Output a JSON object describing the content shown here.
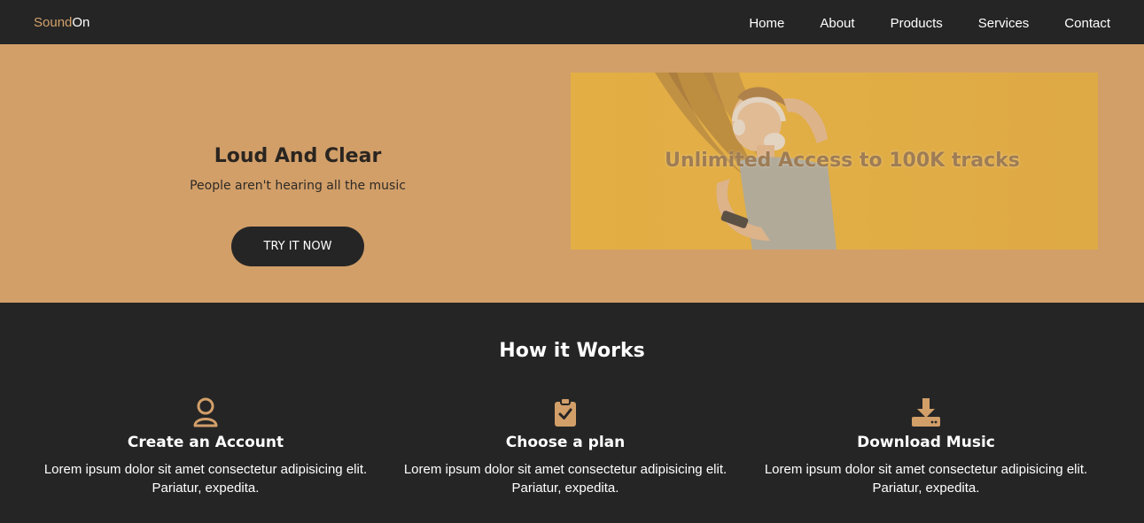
{
  "nav": {
    "logo_part1": "Sound",
    "logo_part2": "On",
    "links": [
      "Home",
      "About",
      "Products",
      "Services",
      "Contact"
    ]
  },
  "hero": {
    "title": "Loud And Clear",
    "subtitle": "People aren't hearing all the music",
    "button": "TRY IT NOW",
    "image_text": "Unlimited Access to 100K tracks"
  },
  "how": {
    "title": "How it Works",
    "steps": [
      {
        "icon": "user-icon",
        "title": "Create an Account",
        "text": "Lorem ipsum dolor sit amet consectetur adipisicing elit. Pariatur, expedita."
      },
      {
        "icon": "clipboard-check-icon",
        "title": "Choose a plan",
        "text": "Lorem ipsum dolor sit amet consectetur adipisicing elit. Pariatur, expedita."
      },
      {
        "icon": "download-icon",
        "title": "Download Music",
        "text": "Lorem ipsum dolor sit amet consectetur adipisicing elit. Pariatur, expedita."
      }
    ]
  },
  "colors": {
    "accent": "#d29f69",
    "dark": "#252525",
    "image_bg": "#e6b23c"
  }
}
